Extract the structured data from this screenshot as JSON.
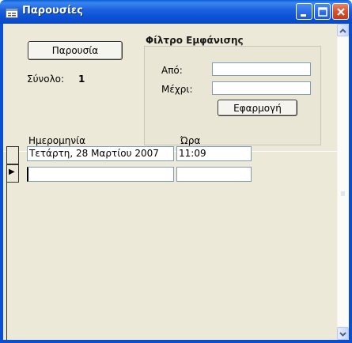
{
  "window": {
    "title": "Παρουσίες"
  },
  "form": {
    "attendance_button": "Παρουσία",
    "total_label": "Σύνολο:",
    "total_value": "1"
  },
  "filter": {
    "heading": "Φίλτρο Εμφάνισης",
    "from_label": "Από:",
    "from_value": "",
    "to_label": "Μέχρι:",
    "to_value": "",
    "apply_button": "Εφαρμογή"
  },
  "records": {
    "columns": [
      "Ημερομηνία",
      "Ώρα"
    ],
    "rows": [
      {
        "date": "Τετάρτη, 28 Μαρτίου 2007",
        "time": "11:09"
      },
      {
        "date": "",
        "time": ""
      }
    ],
    "current_row_marker": "▶"
  },
  "icons": {
    "title": "form-icon",
    "minimize": "minimize-icon",
    "maximize": "maximize-icon",
    "close": "close-icon",
    "scroll_up": "chevron-up-icon",
    "scroll_down": "chevron-down-icon"
  },
  "colors": {
    "titlebar": "#0a4fd0",
    "client_bg": "#ece9d8",
    "close_button": "#d9532f"
  }
}
